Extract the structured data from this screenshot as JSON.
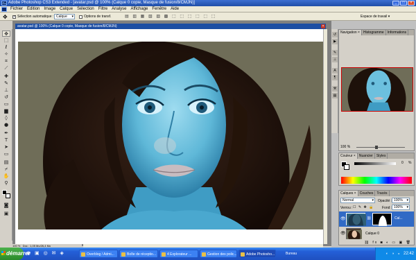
{
  "window": {
    "title": "Adobe Photoshop CS3 Extended - [avatar.psd @ 100% (Calque 0 copie, Masque de fusion/8/CMJN)]"
  },
  "menu": [
    "Fichier",
    "Edition",
    "Image",
    "Calque",
    "Sélection",
    "Filtre",
    "Analyse",
    "Affichage",
    "Fenêtre",
    "Aide"
  ],
  "options": {
    "auto_select_label": "Sélection automatique :",
    "auto_select_value": "Calque",
    "transform_label": "Options de transf.",
    "workspace_label": "Espace de travail ▾"
  },
  "document": {
    "title": "avatar.psd @ 100% (Calque 0 copie, Masque de fusion/8/CMJN)",
    "zoom": "100 %",
    "doc_info": "Doc : 1,05 Mo/26,4 Mo"
  },
  "navigator": {
    "tabs": [
      "Navigation ×",
      "Histogramme",
      "Informations"
    ],
    "zoom": "100 %"
  },
  "color_panel": {
    "tabs": [
      "Couleur ×",
      "Nuancier",
      "Styles"
    ],
    "channel_value": "0",
    "channel_unit": "%"
  },
  "layers_panel": {
    "tabs": [
      "Calques ×",
      "Couches",
      "Tracés"
    ],
    "blend_mode": "Normal",
    "opacity_label": "Opacité :",
    "opacity_value": "100%",
    "lock_label": "Verrou :",
    "fill_label": "Fond :",
    "fill_value": "100%",
    "layers": [
      {
        "name": "Cal...",
        "selected": true
      },
      {
        "name": "Calque 0",
        "selected": false
      }
    ]
  },
  "taskbar": {
    "start": "démarrer",
    "items": [
      "Overblog / Admi...",
      "Boîte de réceptio...",
      "4 Explorateur ...",
      "Gestion des polic...",
      "Adobe Photosho...",
      "Bureau"
    ],
    "clock": "22:42"
  },
  "colors": {
    "accent": "#316ac5",
    "photo_bg": "#6f6d58",
    "skin_tint": "#5fb8d8"
  }
}
